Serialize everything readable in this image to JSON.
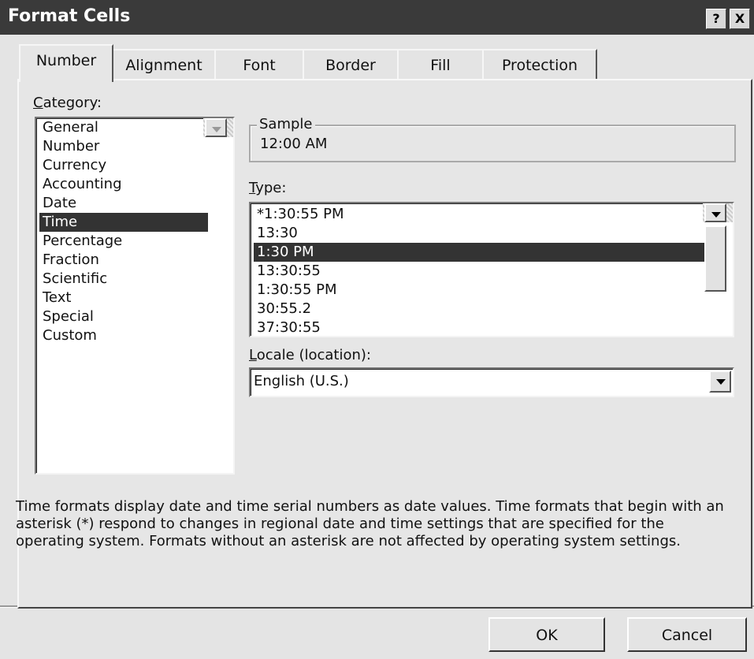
{
  "window": {
    "title": "Format Cells",
    "help_label": "?",
    "close_label": "X"
  },
  "tabs": [
    {
      "label": "Number",
      "active": true
    },
    {
      "label": "Alignment"
    },
    {
      "label": "Font"
    },
    {
      "label": "Border"
    },
    {
      "label": "Fill"
    },
    {
      "label": "Protection"
    }
  ],
  "category": {
    "label_accel": "C",
    "label_rest": "ategory:",
    "items": [
      "General",
      "Number",
      "Currency",
      "Accounting",
      "Date",
      "Time",
      "Percentage",
      "Fraction",
      "Scientific",
      "Text",
      "Special",
      "Custom"
    ],
    "selected": "Time"
  },
  "sample": {
    "label": "Sample",
    "value": "12:00 AM"
  },
  "type": {
    "label_accel": "T",
    "label_rest": "ype:",
    "items": [
      "*1:30:55 PM",
      "13:30",
      "1:30 PM",
      "13:30:55",
      "1:30:55 PM",
      "30:55.2",
      "37:30:55"
    ],
    "selected": "1:30 PM"
  },
  "locale": {
    "label_accel": "L",
    "label_rest": "ocale (location):",
    "value": "English (U.S.)"
  },
  "description": "Time formats display date and time serial numbers as date values.  Time formats that begin with an asterisk (*) respond to changes in regional date and time settings that are specified for the operating system. Formats without an asterisk are not affected by operating system settings.",
  "buttons": {
    "ok": "OK",
    "cancel": "Cancel"
  }
}
